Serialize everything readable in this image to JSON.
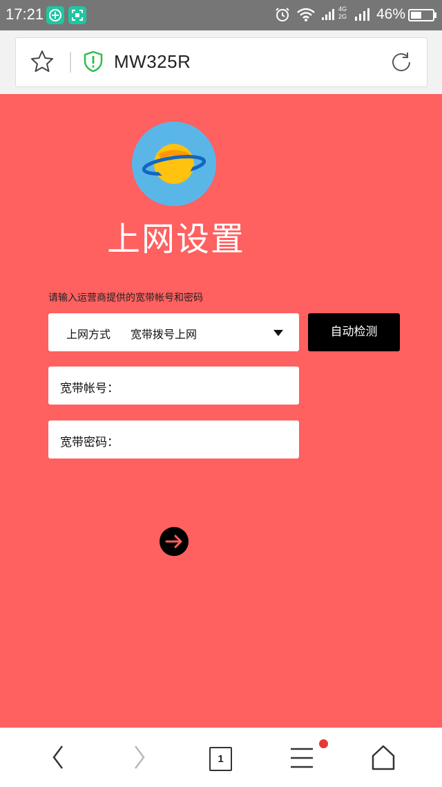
{
  "status_bar": {
    "time": "17:21",
    "battery_percent": "46%",
    "network_top": "4G",
    "network_bottom": "2G",
    "icons": [
      "app-green-plus-icon",
      "app-scan-icon",
      "alarm-icon",
      "wifi-icon",
      "signal-icon",
      "battery-icon"
    ]
  },
  "browser": {
    "page_title": "MW325R",
    "icons": [
      "star-icon",
      "shield-icon",
      "refresh-icon"
    ]
  },
  "page": {
    "title": "上网设置",
    "instructions": "请输入运营商提供的宽带帐号和密码",
    "connection_type": {
      "label": "上网方式",
      "value": "宽带拨号上网"
    },
    "detect_button": "自动检测",
    "account_label": "宽带帐号：",
    "password_label": "宽带密码：",
    "colors": {
      "background": "#ff6060",
      "logo_bg": "#5bb6e8",
      "button": "#000000"
    }
  },
  "bottom_nav": {
    "tab_count": "1",
    "icons": [
      "back-icon",
      "forward-icon",
      "tabs-icon",
      "menu-icon",
      "home-icon"
    ]
  }
}
